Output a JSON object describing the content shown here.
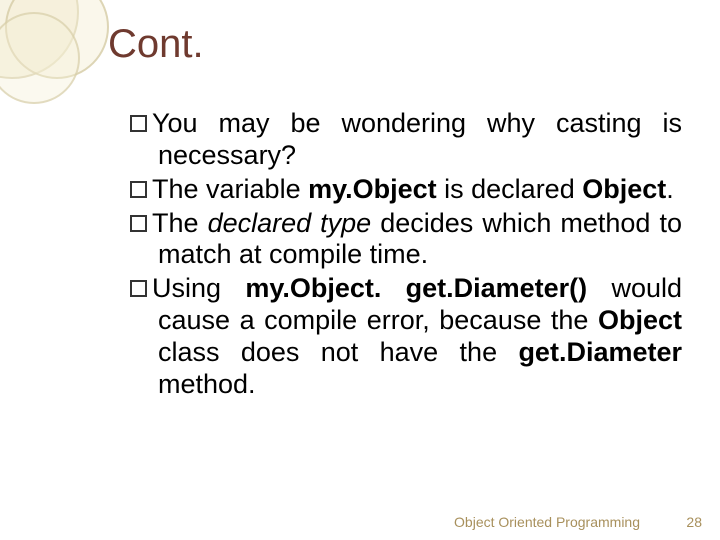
{
  "title": "Cont.",
  "bullets": [
    {
      "parts": [
        {
          "t": "You may be wondering why casting is necessary?",
          "b": false,
          "i": false
        }
      ]
    },
    {
      "parts": [
        {
          "t": "The variable ",
          "b": false,
          "i": false
        },
        {
          "t": "my.Object",
          "b": true,
          "i": false
        },
        {
          "t": " is declared ",
          "b": false,
          "i": false
        },
        {
          "t": "Object",
          "b": true,
          "i": false
        },
        {
          "t": ".",
          "b": false,
          "i": false
        }
      ]
    },
    {
      "parts": [
        {
          "t": "The ",
          "b": false,
          "i": false
        },
        {
          "t": "declared type",
          "b": false,
          "i": true
        },
        {
          "t": " decides which method to match at compile time.",
          "b": false,
          "i": false
        }
      ]
    },
    {
      "parts": [
        {
          "t": "Using ",
          "b": false,
          "i": false
        },
        {
          "t": "my.Object. get.Diameter()",
          "b": true,
          "i": false
        },
        {
          "t": " would cause a compile error, because the ",
          "b": false,
          "i": false
        },
        {
          "t": "Object",
          "b": true,
          "i": false
        },
        {
          "t": " class does not have the ",
          "b": false,
          "i": false
        },
        {
          "t": "get.Diameter",
          "b": true,
          "i": false
        },
        {
          "t": " method.",
          "b": false,
          "i": false
        }
      ]
    }
  ],
  "footer": {
    "text": "Object Oriented Programming",
    "page": "28"
  }
}
